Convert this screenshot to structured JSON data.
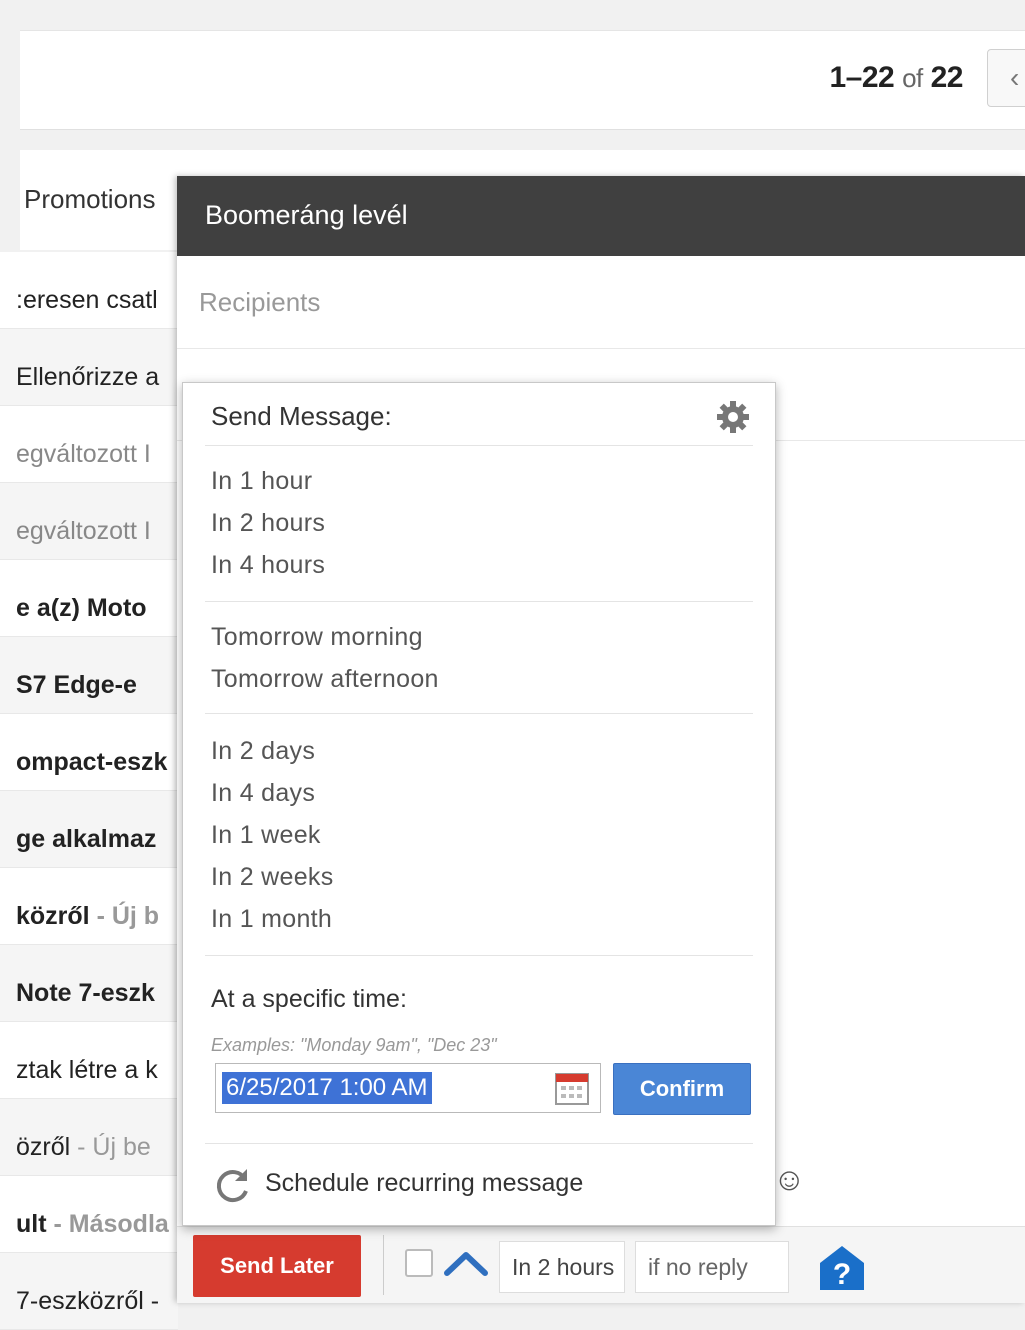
{
  "pager": {
    "range": "1–22",
    "of": "of",
    "total": "22"
  },
  "tabs": {
    "promotions": "Promotions"
  },
  "inbox_rows": [
    {
      "text": ":eresen csatl",
      "style": "normal"
    },
    {
      "text": "Ellenőrizze a",
      "style": "normal"
    },
    {
      "text": "egváltozott I",
      "style": "read"
    },
    {
      "text": "egváltozott I",
      "style": "read"
    },
    {
      "text": "e a(z) Moto",
      "style": "bold"
    },
    {
      "text": "S7 Edge-e",
      "style": "bold"
    },
    {
      "text": "ompact-eszk",
      "style": "bold"
    },
    {
      "text": "ge alkalmaz",
      "style": "bold"
    },
    {
      "text": "közről",
      "sub": "- Új b",
      "style": "bold"
    },
    {
      "text": "Note 7-eszk",
      "style": "bold"
    },
    {
      "text": "ztak létre a k",
      "style": "normal"
    },
    {
      "text": "özről",
      "sub": "- Új be",
      "style": "normal"
    },
    {
      "text": "ult",
      "sub": "- Másodla",
      "style": "bold"
    },
    {
      "text": "7-eszközről -",
      "style": "normal"
    }
  ],
  "compose": {
    "title": "Boomeráng levél",
    "recipients_placeholder": "Recipients"
  },
  "popup": {
    "title": "Send Message:",
    "group1": [
      "In 1 hour",
      "In 2 hours",
      "In 4 hours"
    ],
    "group2": [
      "Tomorrow morning",
      "Tomorrow afternoon"
    ],
    "group3": [
      "In 2 days",
      "In 4 days",
      "In 1 week",
      "In 2 weeks",
      "In 1 month"
    ],
    "specific_title": "At a specific time:",
    "examples": "Examples: \"Monday 9am\", \"Dec 23\"",
    "date_value": "6/25/2017 1:00 AM",
    "confirm_label": "Confirm",
    "recurring_label": "Schedule recurring message"
  },
  "footer": {
    "send_later_label": "Send Later",
    "delay_value": "In 2 hours",
    "condition_value": "if no reply"
  },
  "colors": {
    "send_later": "#d63b2f",
    "confirm": "#4a86d6",
    "header": "#404040",
    "help_icon": "#1a6fc9"
  }
}
